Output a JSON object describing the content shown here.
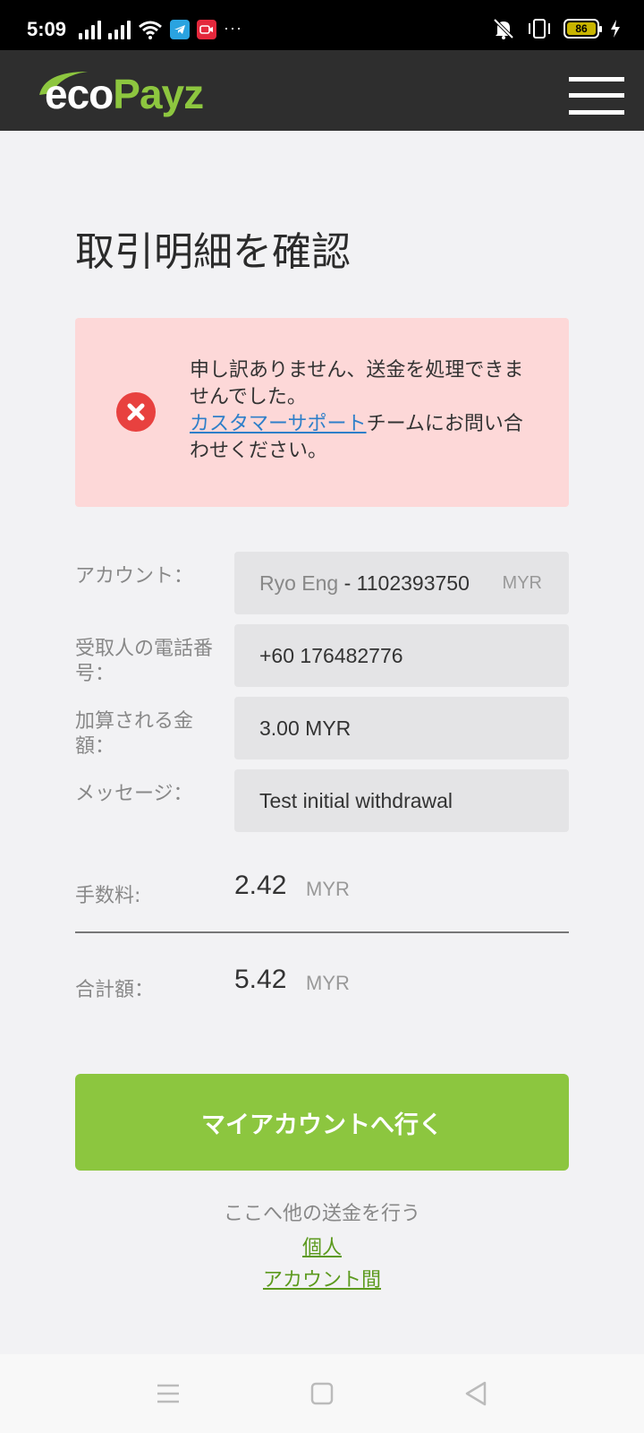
{
  "status_bar": {
    "time": "5:09",
    "battery": "86",
    "icons": [
      "signal-icon",
      "signal-icon",
      "wifi-icon",
      "telegram-icon",
      "screen-record-icon",
      "more-icon",
      "mute-icon",
      "vibrate-icon",
      "battery-icon",
      "charging-icon"
    ]
  },
  "header": {
    "logo_eco": "eco",
    "logo_payz": "Payz",
    "menu_icon": "hamburger-menu-icon"
  },
  "page": {
    "title": "取引明細を確認"
  },
  "error": {
    "line1": "申し訳ありません、送金を処理できませんでした。",
    "link": "カスタマーサポート",
    "line2": "チームにお問い合わせください。",
    "icon": "error-x-icon",
    "bg_color": "#fdd8d8",
    "icon_color": "#e8413f"
  },
  "details": {
    "account": {
      "label": "アカウント：",
      "name": "Ryo Eng",
      "sep": " - ",
      "number": "1102393750",
      "currency": "MYR"
    },
    "phone": {
      "label": "受取人の電話番号：",
      "value": "+60 176482776"
    },
    "amount": {
      "label": "加算される金額：",
      "value": "3.00 MYR"
    },
    "message": {
      "label": "メッセージ：",
      "value": "Test initial withdrawal"
    }
  },
  "summary": {
    "fee": {
      "label": "手数料:",
      "amount": "2.42",
      "currency": "MYR"
    },
    "total": {
      "label": "合計額：",
      "amount": "5.42",
      "currency": "MYR"
    }
  },
  "actions": {
    "cta_label": "マイアカウントへ行く",
    "cta_color": "#8cc63f",
    "other_text": "ここへ他の送金を行う",
    "link_personal": "個人",
    "link_between": "アカウント間",
    "link_color": "#5c9a1e"
  },
  "nav_bar": {
    "icons": [
      "recents-icon",
      "home-icon",
      "back-icon"
    ]
  }
}
